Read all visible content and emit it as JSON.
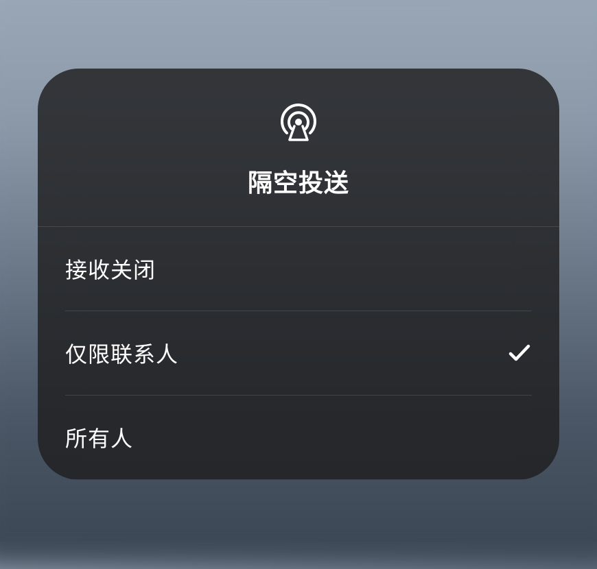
{
  "header": {
    "title": "隔空投送",
    "icon": "airdrop-icon"
  },
  "options": [
    {
      "label": "接收关闭",
      "selected": false
    },
    {
      "label": "仅限联系人",
      "selected": true
    },
    {
      "label": "所有人",
      "selected": false
    }
  ]
}
